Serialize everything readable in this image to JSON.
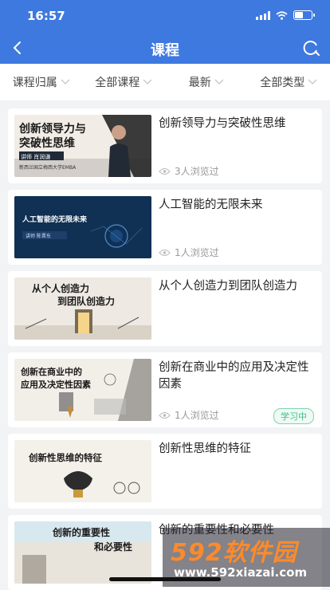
{
  "status": {
    "time": "16:57"
  },
  "nav": {
    "title": "课程"
  },
  "filters": [
    "课程归属",
    "全部课程",
    "最新",
    "全部类型"
  ],
  "courses": [
    {
      "title": "创新领导力与突破性思维",
      "views": "3人浏览过",
      "badge": "",
      "thumb_lines": [
        "创新领导力与",
        "突破性思维"
      ],
      "thumb_sub": "讲师 肖润谦",
      "thumb_sub2": "新西兰国立梅西大学EMBA"
    },
    {
      "title": "人工智能的无限未来",
      "views": "1人浏览过",
      "badge": "",
      "thumb_lines": [
        "人工智能的无限未来"
      ],
      "thumb_sub": "讲师  陈晋东"
    },
    {
      "title": "从个人创造力到团队创造力",
      "views": "",
      "badge": "",
      "thumb_lines": [
        "从个人创造力",
        "到团队创造力"
      ]
    },
    {
      "title": "创新在商业中的应用及决定性因素",
      "views": "1人浏览过",
      "badge": "学习中",
      "thumb_lines": [
        "创新在商业中的",
        "应用及决定性因素"
      ]
    },
    {
      "title": "创新性思维的特征",
      "views": "",
      "badge": "",
      "thumb_lines": [
        "创新性思维的特征"
      ]
    },
    {
      "title": "创新的重要性和必要性",
      "views": "",
      "badge": "",
      "thumb_lines": [
        "创新的重要性",
        "和必要性"
      ]
    }
  ],
  "watermark": {
    "brand": "592软件园",
    "url": "www.592xiazai.com"
  }
}
